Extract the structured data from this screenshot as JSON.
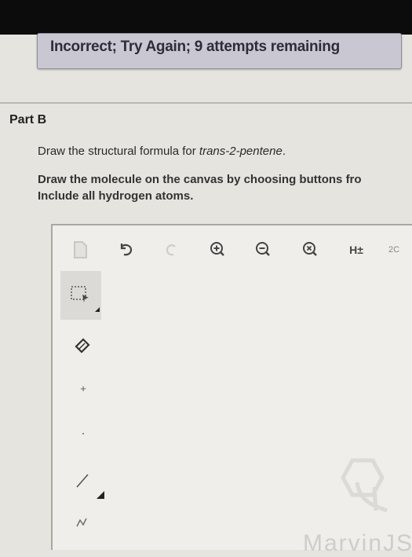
{
  "feedback": {
    "message": "Incorrect; Try Again; 9 attempts remaining"
  },
  "part": {
    "title": "Part B",
    "question_prefix": "Draw the structural formula for ",
    "question_compound": "trans-2-pentene",
    "question_suffix": ".",
    "instruction_line1": "Draw the molecule on the canvas by choosing buttons fro",
    "instruction_line2": "Include all hydrogen atoms."
  },
  "toolbar": {
    "hydrogen_toggle_label": "H±",
    "partial_label": "2C"
  },
  "left_tools": {
    "single_bond_symbol": "+"
  },
  "watermark": {
    "text": "MarvinJS"
  },
  "colors": {
    "feedback_bg": "#c9c8d2",
    "topbar": "#0c0c0c",
    "page_bg": "#e6e4de"
  }
}
